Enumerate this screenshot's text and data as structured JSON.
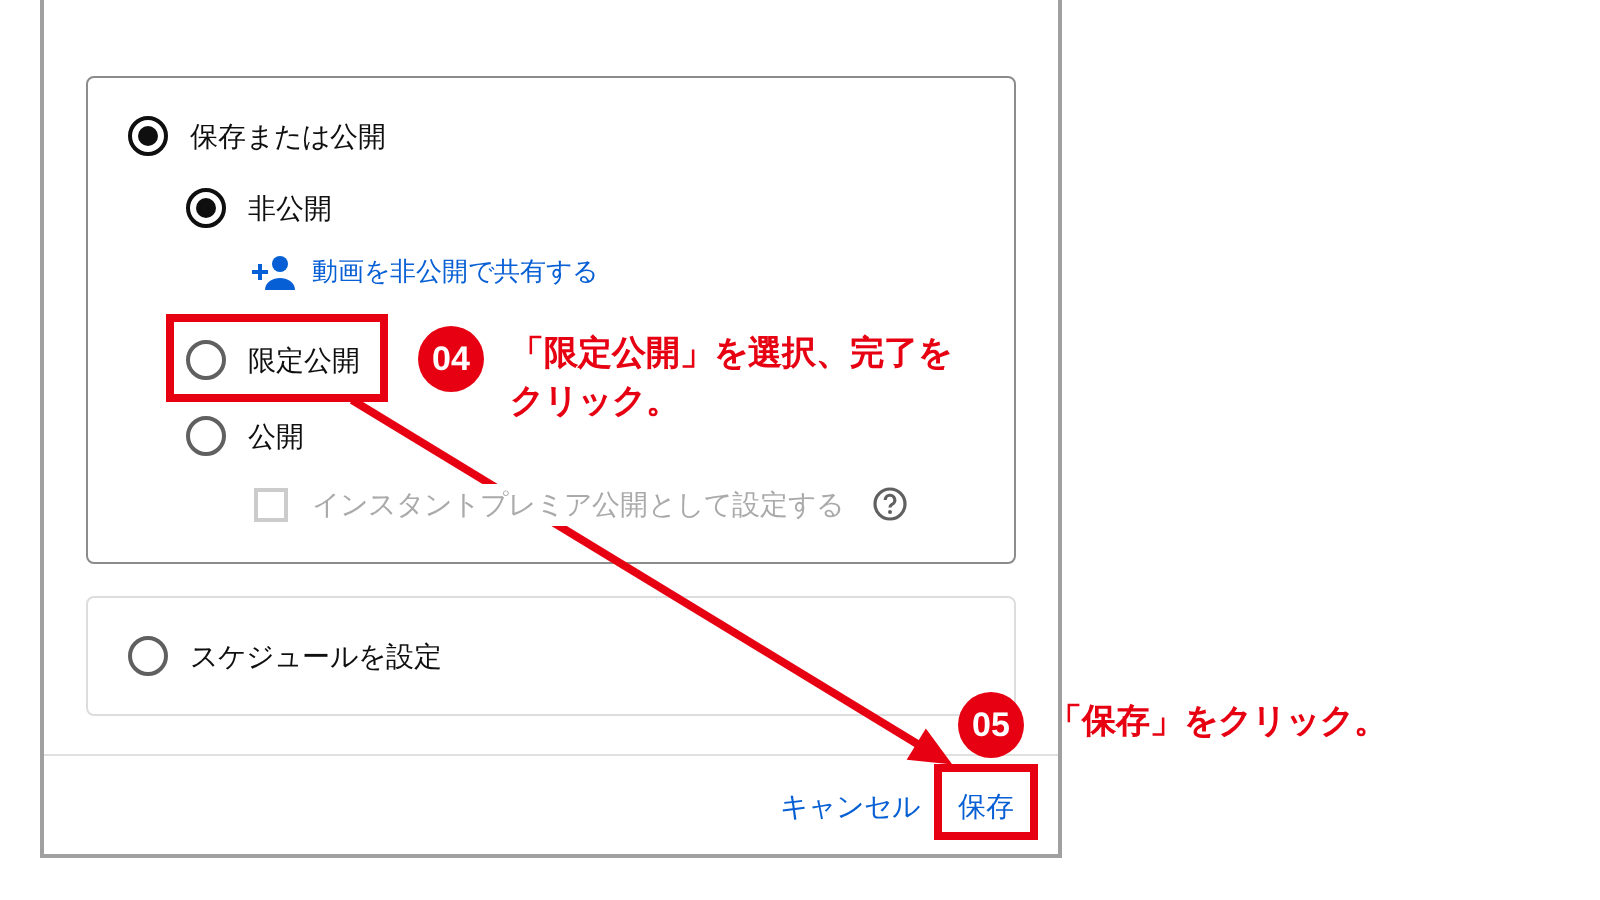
{
  "dialog": {
    "publish_modes": [
      {
        "label": "保存または公開",
        "selected": true
      },
      {
        "label": "スケジュールを設定",
        "selected": false
      }
    ],
    "visibility_options": [
      {
        "kind": "radio",
        "label": "非公開",
        "selected": true
      },
      {
        "kind": "link",
        "label": "動画を非公開で共有する"
      },
      {
        "kind": "radio",
        "label": "限定公開",
        "selected": false
      },
      {
        "kind": "radio",
        "label": "公開",
        "selected": false
      },
      {
        "kind": "checkbox",
        "label": "インスタントプレミア公開として設定する",
        "checked": false,
        "disabled": true
      }
    ],
    "buttons": [
      "キャンセル",
      "保存"
    ]
  },
  "annotations": [
    {
      "number": "04",
      "text": "「限定公開」を選択、完了をクリック。"
    },
    {
      "number": "05",
      "text": "「保存」をクリック。"
    }
  ]
}
